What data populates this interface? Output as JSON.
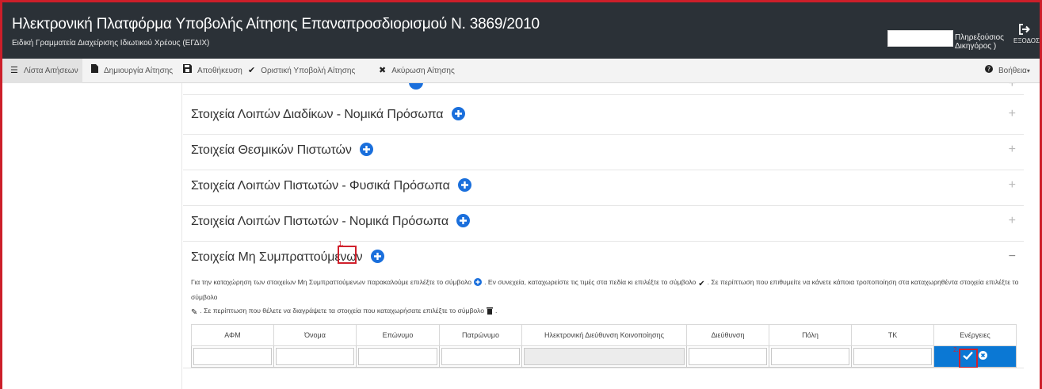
{
  "header": {
    "title": "Ηλεκτρονική Πλατφόρμα Υποβολής Αίτησης Επαναπροσδιορισμού Ν. 3869/2010",
    "subtitle": "Ειδική Γραμματεία Διαχείρισης Ιδιωτικού Χρέους (ΕΓΔΙΧ)",
    "user_role": "Πληρεξούσιος Δικηγόρος )",
    "logout_label": "ΕΞΟΔΟΣ",
    "logout_icon": "logout-icon"
  },
  "nav": {
    "items": [
      {
        "label": "Λίστα Αιτήσεων",
        "icon": "list-icon"
      },
      {
        "label": "Δημιουργία Αίτησης",
        "icon": "file-icon"
      },
      {
        "label": "Αποθήκευση",
        "icon": "save-icon"
      },
      {
        "label": "Οριστική Υποβολή Αίτησης",
        "icon": "check-icon"
      },
      {
        "label": "Ακύρωση Αίτησης",
        "icon": "times-icon"
      }
    ],
    "help_label": "Βοήθεια",
    "help_icon": "question-circle-icon"
  },
  "sections": [
    {
      "label": "Στοιχεία Λοιπών Διαδίκων - Νομικά Πρόσωπα",
      "toggle": "+"
    },
    {
      "label": "Στοιχεία Θεσμικών Πιστωτών",
      "toggle": "+"
    },
    {
      "label": "Στοιχεία Λοιπών Πιστωτών - Φυσικά Πρόσωπα",
      "toggle": "+"
    },
    {
      "label": "Στοιχεία Λοιπών Πιστωτών - Νομικά Πρόσωπα",
      "toggle": "+"
    },
    {
      "label": "Στοιχεία Μη Συμπραττούμενων",
      "toggle": "−"
    }
  ],
  "annotations": {
    "marker_1": "1.",
    "marker_2": "2."
  },
  "instructions": {
    "part1": "Για την καταχώρηση των στοιχείων Μη Συμπραττούμενων παρακαλούμε επιλέξτε το σύμβολο",
    "part2": ". Εν συνεχεία, καταχωρείστε τις τιμές στα πεδία κι επιλέξτε το σύμβολο",
    "part3": ". Σε περίπτωση που επιθυμείτε να κάνετε κάποια τροποποίηση στα καταχωρηθέντα στοιχεία επιλέξτε το σύμβολο",
    "part4": ". Σε περίπτωση που θέλετε να διαγράψετε τα στοιχεία που καταχωρήσατε επιλέξτε το σύμβολο",
    "part5": "."
  },
  "table": {
    "columns": [
      "ΑΦΜ",
      "Όνομα",
      "Επώνυμο",
      "Πατρώνυμο",
      "Ηλεκτρονική Διεύθυνση Κοινοποίησης",
      "Διεύθυνση",
      "Πόλη",
      "ΤΚ",
      "Ενέργειες"
    ],
    "row_values": [
      "",
      "",
      "",
      "",
      "",
      "",
      "",
      ""
    ],
    "disabled_column": "Ηλεκτρονική Διεύθυνση Κοινοποίησης"
  },
  "colors": {
    "header_bg": "#2b3137",
    "accent_blue": "#0b78d4",
    "highlight_red": "#d0202c"
  }
}
